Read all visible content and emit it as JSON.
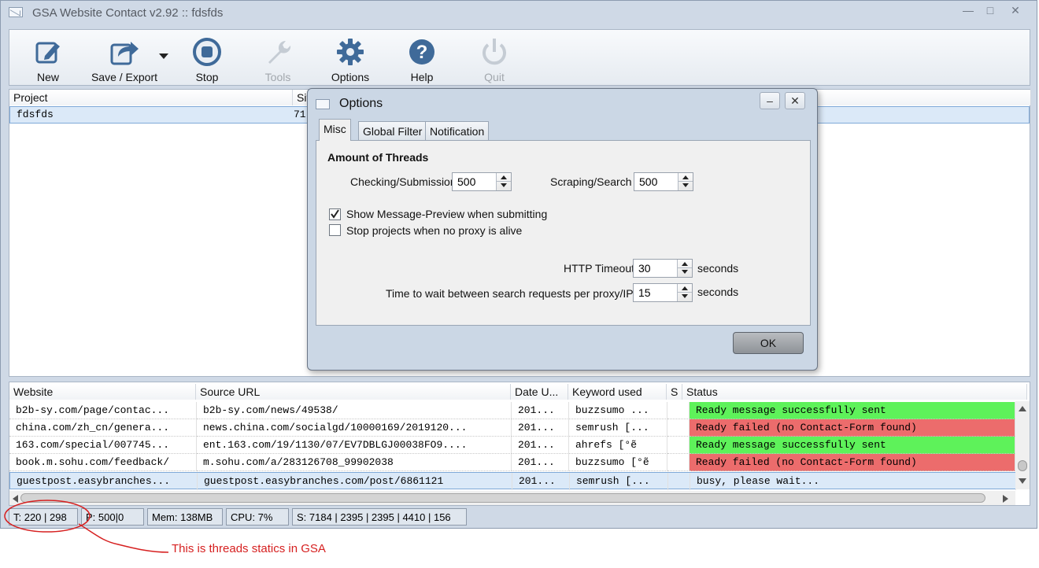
{
  "window": {
    "title": "GSA Website Contact v2.92 :: fdsfds"
  },
  "toolbar": {
    "new": "New",
    "save_export": "Save / Export",
    "stop": "Stop",
    "tools": "Tools",
    "options": "Options",
    "help": "Help",
    "quit": "Quit"
  },
  "projects": {
    "headers": {
      "project": "Project",
      "site": "Site"
    },
    "rows": [
      {
        "project": "fdsfds",
        "site": "71"
      }
    ]
  },
  "dialog": {
    "title": "Options",
    "tabs": {
      "misc": "Misc",
      "global_filter": "Global Filter",
      "notification": "Notification"
    },
    "section_title": "Amount of Threads",
    "checking_label": "Checking/Submission",
    "checking_value": "500",
    "scraping_label": "Scraping/Search",
    "scraping_value": "500",
    "show_preview_label": "Show Message-Preview when submitting",
    "show_preview_checked": true,
    "stop_projects_label": "Stop projects when no proxy is alive",
    "stop_projects_checked": false,
    "http_timeout_label": "HTTP Timeout",
    "http_timeout_value": "30",
    "http_timeout_unit": "seconds",
    "wait_label": "Time to wait between search requests per proxy/IP",
    "wait_value": "15",
    "wait_unit": "seconds",
    "ok": "OK"
  },
  "results": {
    "headers": {
      "website": "Website",
      "source": "Source URL",
      "date": "Date U...",
      "keyword": "Keyword used",
      "s": "S",
      "status": "Status"
    },
    "rows": [
      {
        "website": "b2b-sy.com/page/contac...",
        "source": "b2b-sy.com/news/49538/",
        "date": "201...",
        "keyword": "buzzsumo ...",
        "status": "Ready message successfully sent"
      },
      {
        "website": "china.com/zh_cn/genera...",
        "source": "news.china.com/socialgd/10000169/2019120...",
        "date": "201...",
        "keyword": "semrush [...",
        "status": "Ready failed (no Contact-Form found)"
      },
      {
        "website": "163.com/special/007745...",
        "source": "ent.163.com/19/1130/07/EV7DBLGJ00038FO9....",
        "date": "201...",
        "keyword": "ahrefs [°ẽ",
        "status": "Ready message successfully sent"
      },
      {
        "website": "book.m.sohu.com/feedback/",
        "source": "m.sohu.com/a/283126708_99902038",
        "date": "201...",
        "keyword": "buzzsumo [°ẽ",
        "status": "Ready failed (no Contact-Form found)"
      },
      {
        "website": "guestpost.easybranches...",
        "source": "guestpost.easybranches.com/post/6861121",
        "date": "201...",
        "keyword": "semrush [...",
        "status": "busy, please wait..."
      }
    ]
  },
  "statusbar": {
    "threads": "T: 220 | 298",
    "proxies": "P: 500|0",
    "mem": "Mem: 138MB",
    "cpu": "CPU: 7%",
    "stats": "S: 7184 | 2395 | 2395 | 4410 | 156"
  },
  "annotation": {
    "text": "This is threads statics in GSA",
    "color": "#d62020"
  },
  "colors": {
    "success": "#5ef25a",
    "failed": "#ec6c6c",
    "selected": "#dbe9f8"
  }
}
